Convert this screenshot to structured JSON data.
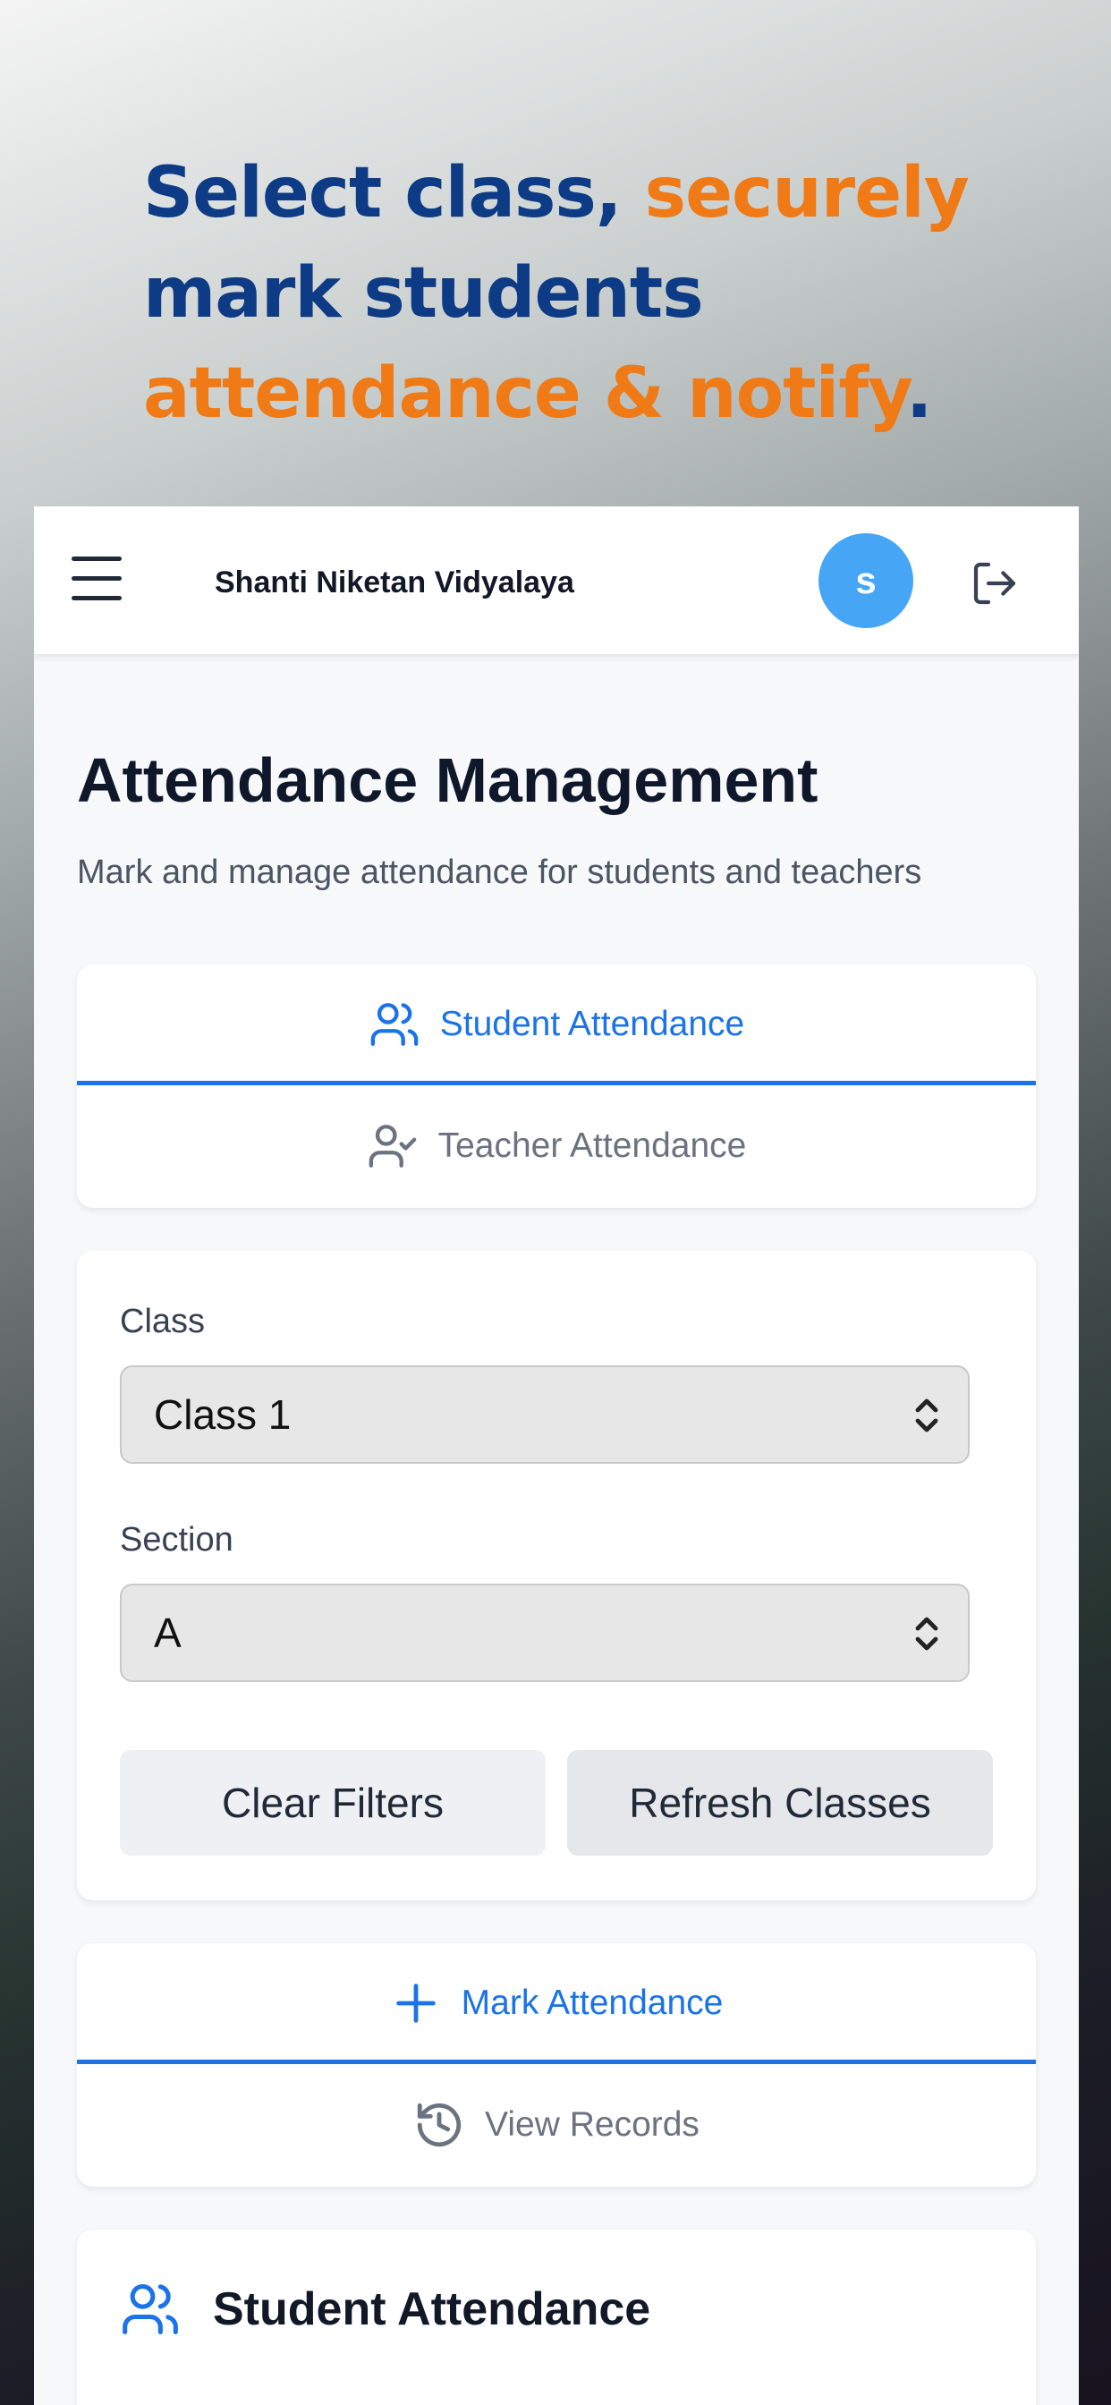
{
  "headline": {
    "part1": "Select class, ",
    "part2": "securely",
    "part3": "mark students",
    "part4": "attendance & notify",
    "part5": "."
  },
  "topbar": {
    "school_name": "Shanti Niketan Vidyalaya",
    "avatar_initial": "s",
    "menu_icon": "hamburger-menu-icon",
    "logout_icon": "logout-icon"
  },
  "page": {
    "title": "Attendance Management",
    "subtitle": "Mark and manage attendance for students and teachers"
  },
  "attendance_tabs": [
    {
      "label": "Student Attendance",
      "icon": "users-icon",
      "active": true
    },
    {
      "label": "Teacher Attendance",
      "icon": "user-check-icon",
      "active": false
    }
  ],
  "filters": {
    "class_label": "Class",
    "class_value": "Class 1",
    "section_label": "Section",
    "section_value": "A",
    "clear_label": "Clear Filters",
    "refresh_label": "Refresh Classes"
  },
  "mode_tabs": [
    {
      "label": "Mark Attendance",
      "icon": "plus-icon",
      "active": true
    },
    {
      "label": "View Records",
      "icon": "history-icon",
      "active": false
    }
  ],
  "student_section": {
    "title": "Student Attendance",
    "icon": "users-icon"
  },
  "colors": {
    "brand_blue": "#0d3b85",
    "accent_orange": "#ef7a16",
    "active_tab": "#1a73e8",
    "avatar": "#46a6f5"
  }
}
